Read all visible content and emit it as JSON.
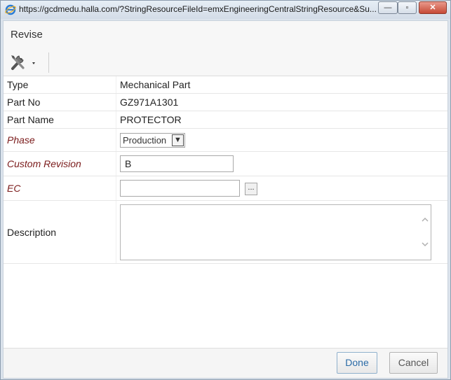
{
  "window": {
    "url": "https://gcdmedu.halla.com/?StringResourceFileId=emxEngineeringCentralStringResource&Su...",
    "minimize_glyph": "—",
    "maximize_glyph": "▫",
    "close_glyph": "✕"
  },
  "dialog": {
    "title": "Revise",
    "toolbar": {
      "actions_icon": "tools-icon"
    },
    "fields": {
      "type": {
        "label": "Type",
        "value": "Mechanical Part"
      },
      "part_no": {
        "label": "Part No",
        "value": "GZ971A1301"
      },
      "part_name": {
        "label": "Part Name",
        "value": "PROTECTOR"
      },
      "phase": {
        "label": "Phase",
        "value": "Production",
        "arrow": "▼"
      },
      "custom_revision": {
        "label": "Custom Revision",
        "value": "B"
      },
      "ec": {
        "label": "EC",
        "value": "",
        "button": "..."
      },
      "description": {
        "label": "Description",
        "value": ""
      }
    },
    "footer": {
      "done_label": "Done",
      "cancel_label": "Cancel"
    }
  },
  "colors": {
    "required_label": "#7a1a1a",
    "done_text": "#2a6aa6"
  }
}
